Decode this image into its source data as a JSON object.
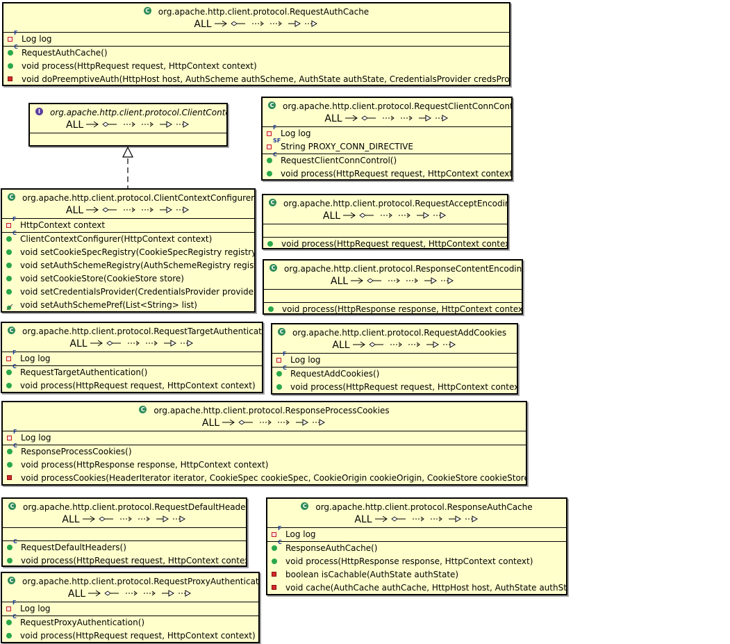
{
  "filter_label": "ALL",
  "generalization": {
    "from": "org.apache.http.client.protocol.ClientContextConfigurer",
    "to": "org.apache.http.client.protocol.ClientContext",
    "kind": "realization"
  },
  "icons": {
    "class": "class-icon",
    "interface": "interface-icon",
    "private_field": "private-field-icon",
    "private_method": "private-method-icon",
    "public_method": "public-method-icon",
    "protected_method": "protected-method-icon"
  },
  "colors": {
    "box_fill": "#ffffcc",
    "border": "#000000",
    "public": "#2aa84a",
    "private": "#d02a2a",
    "interface_icon": "#5b3fa0",
    "class_icon": "#2e8b57"
  },
  "classes": [
    {
      "id": "RequestAuthCache",
      "name": "org.apache.http.client.protocol.RequestAuthCache",
      "kind": "class",
      "fields": [
        {
          "vis": "private",
          "mod": "F",
          "text": "Log log"
        }
      ],
      "methods": [
        {
          "vis": "public",
          "mod": "C",
          "text": "RequestAuthCache()"
        },
        {
          "vis": "public",
          "mod": "",
          "text": "void process(HttpRequest request, HttpContext context)"
        },
        {
          "vis": "private",
          "mod": "",
          "text": "void doPreemptiveAuth(HttpHost host, AuthScheme authScheme, AuthState authState, CredentialsProvider credsProvider)"
        }
      ]
    },
    {
      "id": "ClientContext",
      "name": "org.apache.http.client.protocol.ClientContext",
      "kind": "interface",
      "fields": [],
      "methods": []
    },
    {
      "id": "RequestClientConnControl",
      "name": "org.apache.http.client.protocol.RequestClientConnControl",
      "kind": "class",
      "fields": [
        {
          "vis": "private",
          "mod": "F",
          "text": "Log log"
        },
        {
          "vis": "private",
          "mod": "SF",
          "text": "String PROXY_CONN_DIRECTIVE"
        }
      ],
      "methods": [
        {
          "vis": "public",
          "mod": "C",
          "text": "RequestClientConnControl()"
        },
        {
          "vis": "public",
          "mod": "",
          "text": "void process(HttpRequest request, HttpContext context)"
        }
      ]
    },
    {
      "id": "ClientContextConfigurer",
      "name": "org.apache.http.client.protocol.ClientContextConfigurer",
      "kind": "class",
      "fields": [
        {
          "vis": "private",
          "mod": "F",
          "text": "HttpContext context"
        }
      ],
      "methods": [
        {
          "vis": "public",
          "mod": "C",
          "text": "ClientContextConfigurer(HttpContext context)"
        },
        {
          "vis": "public",
          "mod": "",
          "text": "void setCookieSpecRegistry(CookieSpecRegistry registry)"
        },
        {
          "vis": "public",
          "mod": "",
          "text": "void setAuthSchemeRegistry(AuthSchemeRegistry registry)"
        },
        {
          "vis": "public",
          "mod": "",
          "text": "void setCookieStore(CookieStore store)"
        },
        {
          "vis": "public",
          "mod": "",
          "text": "void setCredentialsProvider(CredentialsProvider provider)"
        },
        {
          "vis": "protected",
          "mod": "",
          "text": "void setAuthSchemePref(List<String> list)"
        }
      ]
    },
    {
      "id": "RequestAcceptEncoding",
      "name": "org.apache.http.client.protocol.RequestAcceptEncoding",
      "kind": "class",
      "fields": [],
      "methods": [
        {
          "vis": "public",
          "mod": "",
          "text": "void process(HttpRequest request, HttpContext context)"
        }
      ]
    },
    {
      "id": "ResponseContentEncoding",
      "name": "org.apache.http.client.protocol.ResponseContentEncoding",
      "kind": "class",
      "fields": [],
      "methods": [
        {
          "vis": "public",
          "mod": "",
          "text": "void process(HttpResponse response, HttpContext context)"
        }
      ]
    },
    {
      "id": "RequestTargetAuthentication",
      "name": "org.apache.http.client.protocol.RequestTargetAuthentication",
      "kind": "class",
      "fields": [
        {
          "vis": "private",
          "mod": "F",
          "text": "Log log"
        }
      ],
      "methods": [
        {
          "vis": "public",
          "mod": "C",
          "text": "RequestTargetAuthentication()"
        },
        {
          "vis": "public",
          "mod": "",
          "text": "void process(HttpRequest request, HttpContext context)"
        }
      ]
    },
    {
      "id": "RequestAddCookies",
      "name": "org.apache.http.client.protocol.RequestAddCookies",
      "kind": "class",
      "fields": [
        {
          "vis": "private",
          "mod": "F",
          "text": "Log log"
        }
      ],
      "methods": [
        {
          "vis": "public",
          "mod": "C",
          "text": "RequestAddCookies()"
        },
        {
          "vis": "public",
          "mod": "",
          "text": "void process(HttpRequest request, HttpContext context)"
        }
      ]
    },
    {
      "id": "ResponseProcessCookies",
      "name": "org.apache.http.client.protocol.ResponseProcessCookies",
      "kind": "class",
      "fields": [
        {
          "vis": "private",
          "mod": "F",
          "text": "Log log"
        }
      ],
      "methods": [
        {
          "vis": "public",
          "mod": "C",
          "text": "ResponseProcessCookies()"
        },
        {
          "vis": "public",
          "mod": "",
          "text": "void process(HttpResponse response, HttpContext context)"
        },
        {
          "vis": "private",
          "mod": "",
          "text": "void processCookies(HeaderIterator iterator, CookieSpec cookieSpec, CookieOrigin cookieOrigin, CookieStore cookieStore)"
        }
      ]
    },
    {
      "id": "RequestDefaultHeaders",
      "name": "org.apache.http.client.protocol.RequestDefaultHeaders",
      "kind": "class",
      "fields": [],
      "methods": [
        {
          "vis": "public",
          "mod": "C",
          "text": "RequestDefaultHeaders()"
        },
        {
          "vis": "public",
          "mod": "",
          "text": "void process(HttpRequest request, HttpContext context)"
        }
      ]
    },
    {
      "id": "ResponseAuthCache",
      "name": "org.apache.http.client.protocol.ResponseAuthCache",
      "kind": "class",
      "fields": [
        {
          "vis": "private",
          "mod": "F",
          "text": "Log log"
        }
      ],
      "methods": [
        {
          "vis": "public",
          "mod": "C",
          "text": "ResponseAuthCache()"
        },
        {
          "vis": "public",
          "mod": "",
          "text": "void process(HttpResponse response, HttpContext context)"
        },
        {
          "vis": "private",
          "mod": "",
          "text": "boolean isCachable(AuthState authState)"
        },
        {
          "vis": "private",
          "mod": "",
          "text": "void cache(AuthCache authCache, HttpHost host, AuthState authState)"
        }
      ]
    },
    {
      "id": "RequestProxyAuthentication",
      "name": "org.apache.http.client.protocol.RequestProxyAuthentication",
      "kind": "class",
      "fields": [
        {
          "vis": "private",
          "mod": "F",
          "text": "Log log"
        }
      ],
      "methods": [
        {
          "vis": "public",
          "mod": "C",
          "text": "RequestProxyAuthentication()"
        },
        {
          "vis": "public",
          "mod": "",
          "text": "void process(HttpRequest request, HttpContext context)"
        }
      ]
    }
  ]
}
